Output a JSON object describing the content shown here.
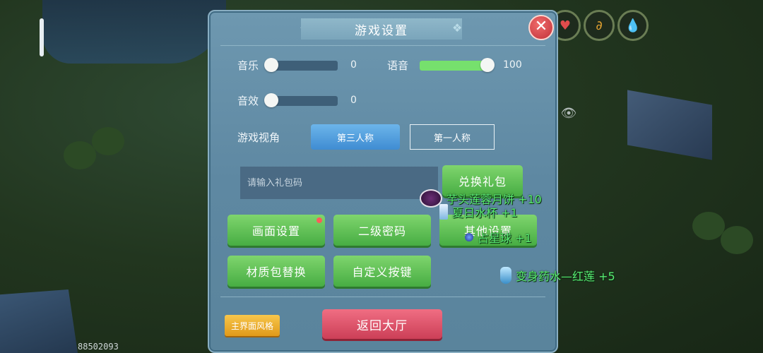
{
  "dialog": {
    "title": "游戏设置",
    "close_icon": "close-icon"
  },
  "audio": {
    "music": {
      "label": "音乐",
      "value": "0",
      "level": 0
    },
    "voice": {
      "label": "语音",
      "value": "100",
      "level": 100
    },
    "sfx": {
      "label": "音效",
      "value": "0",
      "level": 0
    }
  },
  "view": {
    "label": "游戏视角",
    "third_person": "第三人称",
    "first_person": "第一人称",
    "selected": "第三人称"
  },
  "gift": {
    "placeholder": "请输入礼包码",
    "redeem_label": "兑换礼包"
  },
  "menu": {
    "graphics": "画面设置",
    "second_password": "二级密码",
    "other": "其他设置",
    "texture_pack": "材质包替换",
    "custom_keys": "自定义按键"
  },
  "footer": {
    "theme": "主界面风格",
    "back_to_lobby": "返回大厅"
  },
  "rewards": [
    {
      "text": "芋头莲蓉月饼 +10",
      "icon": "mooncake-icon"
    },
    {
      "text": "夏日水杯 +1",
      "icon": "cup-icon"
    },
    {
      "text": "占星球 +1",
      "icon": "orb-icon"
    },
    {
      "text": "变身药水—红莲 +5",
      "icon": "potion-icon"
    }
  ],
  "hud": {
    "uid": "88502093"
  },
  "colors": {
    "panel": "#6e98b0",
    "slider_fill": "#76e06d",
    "primary": "#4fb04a",
    "danger": "#d6485f",
    "accent": "#f0b030"
  }
}
